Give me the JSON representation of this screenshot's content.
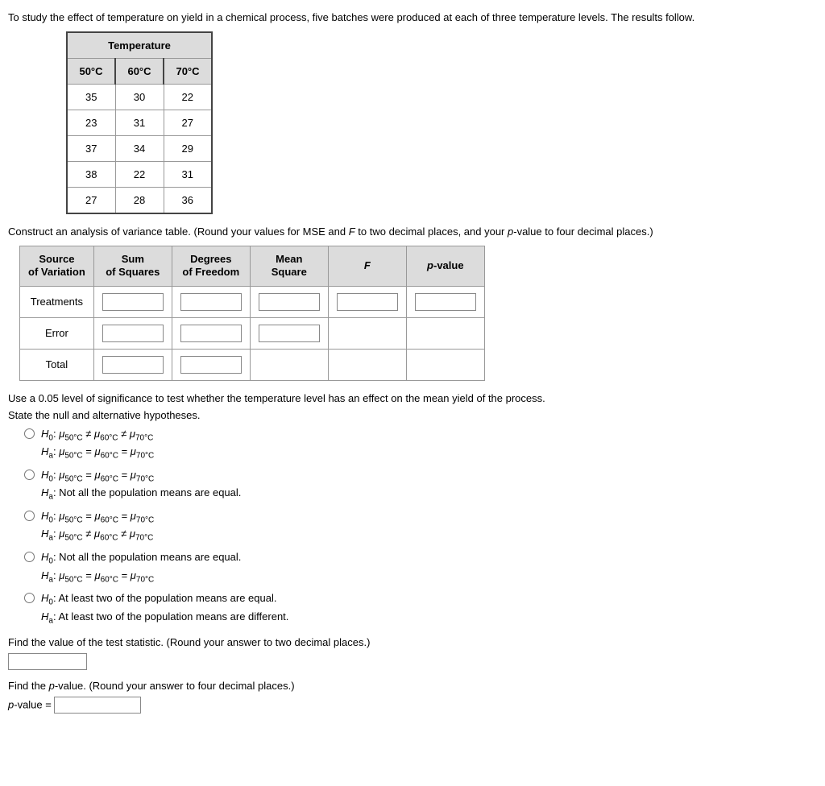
{
  "intro": "To study the effect of temperature on yield in a chemical process, five batches were produced at each of three temperature levels. The results follow.",
  "temp_table": {
    "group_header": "Temperature",
    "columns": [
      "50°C",
      "60°C",
      "70°C"
    ],
    "rows": [
      [
        "35",
        "30",
        "22"
      ],
      [
        "23",
        "31",
        "27"
      ],
      [
        "37",
        "34",
        "29"
      ],
      [
        "38",
        "22",
        "31"
      ],
      [
        "27",
        "28",
        "36"
      ]
    ]
  },
  "anova_instructions": "Construct an analysis of variance table. (Round your values for MSE and F to two decimal places, and your p-value to four decimal places.)",
  "anova": {
    "headers": {
      "source": "Source\nof Variation",
      "ss": "Sum\nof Squares",
      "df": "Degrees\nof Freedom",
      "ms": "Mean\nSquare",
      "f": "F",
      "p": "p-value"
    },
    "rows": {
      "treatments": "Treatments",
      "error": "Error",
      "total": "Total"
    }
  },
  "sig_test": "Use a 0.05 level of significance to test whether the temperature level has an effect on the mean yield of the process.",
  "state_hyp": "State the null and alternative hypotheses.",
  "opts": {
    "1": {
      "h0": "H₀: μ₅₀°C ≠ μ₆₀°C ≠ μ₇₀°C",
      "ha": "Hₐ: μ₅₀°C = μ₆₀°C = μ₇₀°C"
    },
    "2": {
      "h0": "H₀: μ₅₀°C = μ₆₀°C = μ₇₀°C",
      "ha": "Hₐ: Not all the population means are equal."
    },
    "3": {
      "h0": "H₀: μ₅₀°C = μ₆₀°C = μ₇₀°C",
      "ha": "Hₐ: μ₅₀°C ≠ μ₆₀°C ≠ μ₇₀°C"
    },
    "4": {
      "h0": "H₀: Not all the population means are equal.",
      "ha": "Hₐ: μ₅₀°C = μ₆₀°C = μ₇₀°C"
    },
    "5": {
      "h0": "H₀: At least two of the population means are equal.",
      "ha": "Hₐ: At least two of the population means are different."
    }
  },
  "find_test_stat": "Find the value of the test statistic. (Round your answer to two decimal places.)",
  "find_pvalue": "Find the p-value. (Round your answer to four decimal places.)",
  "pvalue_label": "p-value = "
}
